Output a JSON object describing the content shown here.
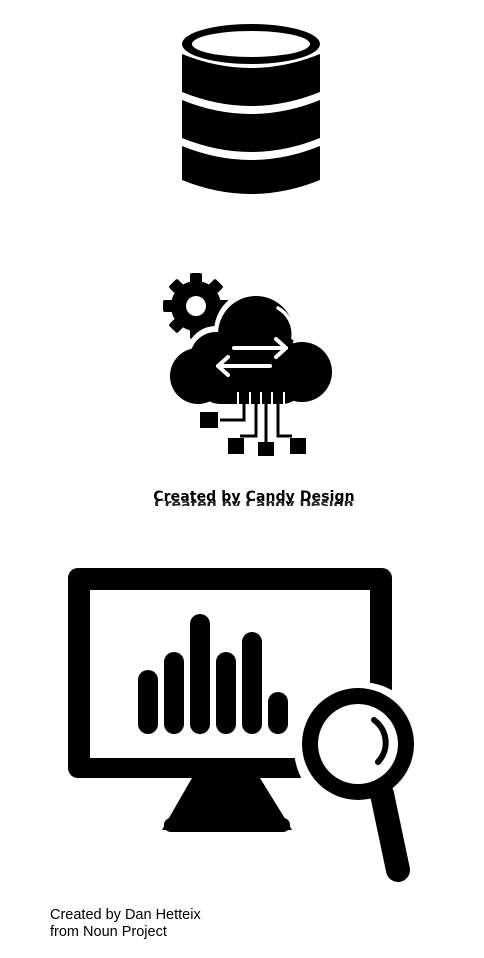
{
  "icons": [
    {
      "name": "database-icon"
    },
    {
      "name": "cloud-data-transfer-icon"
    },
    {
      "name": "monitor-analytics-icon"
    }
  ],
  "credits": {
    "candy": "Created by Candy Design",
    "dan_line1": "Created by Dan Hetteix",
    "dan_line2": "from Noun Project"
  },
  "colors": {
    "icon": "#000000",
    "background": "#ffffff"
  }
}
